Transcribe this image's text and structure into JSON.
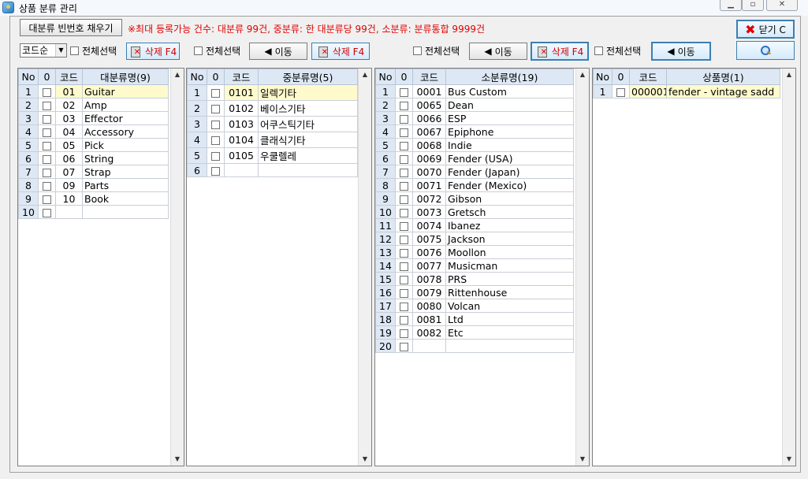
{
  "window": {
    "title": "상품 분류 관리"
  },
  "toolbar": {
    "fill_button": "대분류 빈번호 채우기",
    "notice": "※최대 등록가능 건수: 대분류 99건, 중분류: 한 대분류당 99건, 소분류: 분류통합 9999건",
    "sort_value": "코드순",
    "select_all": "전체선택",
    "delete": "삭제 F4",
    "move": "이동",
    "close": "닫기 C"
  },
  "major": {
    "headers": [
      "No",
      "0",
      "코드",
      "대분류명(9)"
    ],
    "rows": [
      {
        "no": "1",
        "code": "01",
        "name": "Guitar"
      },
      {
        "no": "2",
        "code": "02",
        "name": "Amp"
      },
      {
        "no": "3",
        "code": "03",
        "name": "Effector"
      },
      {
        "no": "4",
        "code": "04",
        "name": "Accessory"
      },
      {
        "no": "5",
        "code": "05",
        "name": "Pick"
      },
      {
        "no": "6",
        "code": "06",
        "name": "String"
      },
      {
        "no": "7",
        "code": "07",
        "name": "Strap"
      },
      {
        "no": "8",
        "code": "09",
        "name": "Parts"
      },
      {
        "no": "9",
        "code": "10",
        "name": "Book"
      },
      {
        "no": "10",
        "code": "",
        "name": ""
      }
    ]
  },
  "middle": {
    "headers": [
      "No",
      "0",
      "코드",
      "중분류명(5)"
    ],
    "rows": [
      {
        "no": "1",
        "code": "0101",
        "name": "일렉기타"
      },
      {
        "no": "2",
        "code": "0102",
        "name": "베이스기타"
      },
      {
        "no": "3",
        "code": "0103",
        "name": "어쿠스틱기타"
      },
      {
        "no": "4",
        "code": "0104",
        "name": "클래식기타"
      },
      {
        "no": "5",
        "code": "0105",
        "name": "우쿨렐레"
      },
      {
        "no": "6",
        "code": "",
        "name": ""
      }
    ]
  },
  "minor": {
    "headers": [
      "No",
      "0",
      "코드",
      "소분류명(19)"
    ],
    "rows": [
      {
        "no": "1",
        "code": "0001",
        "name": "Bus Custom"
      },
      {
        "no": "2",
        "code": "0065",
        "name": "Dean"
      },
      {
        "no": "3",
        "code": "0066",
        "name": "ESP"
      },
      {
        "no": "4",
        "code": "0067",
        "name": "Epiphone"
      },
      {
        "no": "5",
        "code": "0068",
        "name": "Indie"
      },
      {
        "no": "6",
        "code": "0069",
        "name": "Fender (USA)"
      },
      {
        "no": "7",
        "code": "0070",
        "name": "Fender (Japan)"
      },
      {
        "no": "8",
        "code": "0071",
        "name": "Fender (Mexico)"
      },
      {
        "no": "9",
        "code": "0072",
        "name": "Gibson"
      },
      {
        "no": "10",
        "code": "0073",
        "name": "Gretsch"
      },
      {
        "no": "11",
        "code": "0074",
        "name": "Ibanez"
      },
      {
        "no": "12",
        "code": "0075",
        "name": "Jackson"
      },
      {
        "no": "13",
        "code": "0076",
        "name": "Moollon"
      },
      {
        "no": "14",
        "code": "0077",
        "name": "Musicman"
      },
      {
        "no": "15",
        "code": "0078",
        "name": "PRS"
      },
      {
        "no": "16",
        "code": "0079",
        "name": "Rittenhouse"
      },
      {
        "no": "17",
        "code": "0080",
        "name": "Volcan"
      },
      {
        "no": "18",
        "code": "0081",
        "name": "Ltd"
      },
      {
        "no": "19",
        "code": "0082",
        "name": "Etc"
      },
      {
        "no": "20",
        "code": "",
        "name": ""
      }
    ]
  },
  "product": {
    "headers": [
      "No",
      "0",
      "코드",
      "상품명(1)"
    ],
    "rows": [
      {
        "no": "1",
        "code": "000001",
        "name": "fender - vintage sadd"
      }
    ]
  }
}
